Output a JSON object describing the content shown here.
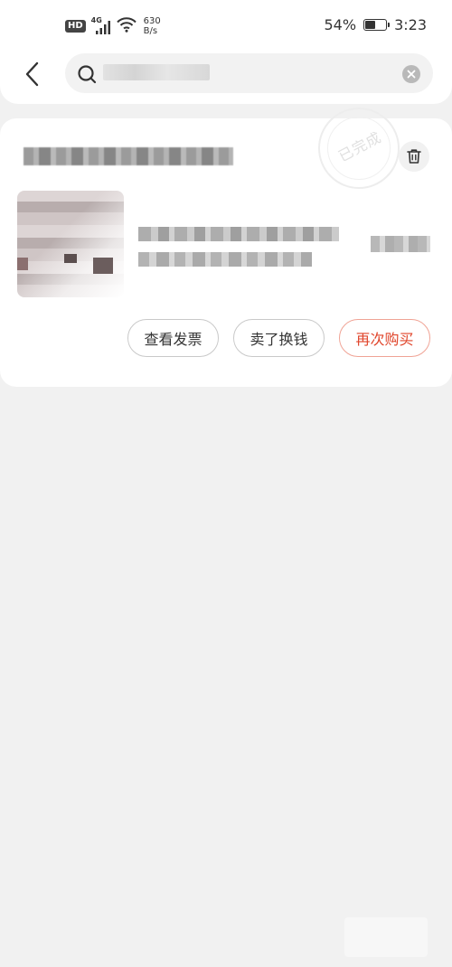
{
  "status_bar": {
    "hd": "HD",
    "network": "4G",
    "net_speed_value": "630",
    "net_speed_unit": "B/s",
    "battery_percent": "54%",
    "battery_level": 0.54,
    "time": "3:23"
  },
  "header": {
    "search_placeholder": "",
    "search_value": ""
  },
  "order": {
    "status_stamp": "已完成",
    "actions": {
      "view_invoice": "查看发票",
      "sell_for_cash": "卖了换钱",
      "buy_again": "再次购买"
    }
  },
  "colors": {
    "accent": "#e0452b",
    "accent_border": "#f0a395",
    "page_bg": "#f1f1f1",
    "card_bg": "#ffffff"
  },
  "icons": {
    "back": "chevron-left-icon",
    "search": "search-icon",
    "clear": "clear-icon",
    "delete": "trash-icon",
    "wifi": "wifi-icon",
    "signal": "signal-icon",
    "battery": "battery-icon"
  }
}
